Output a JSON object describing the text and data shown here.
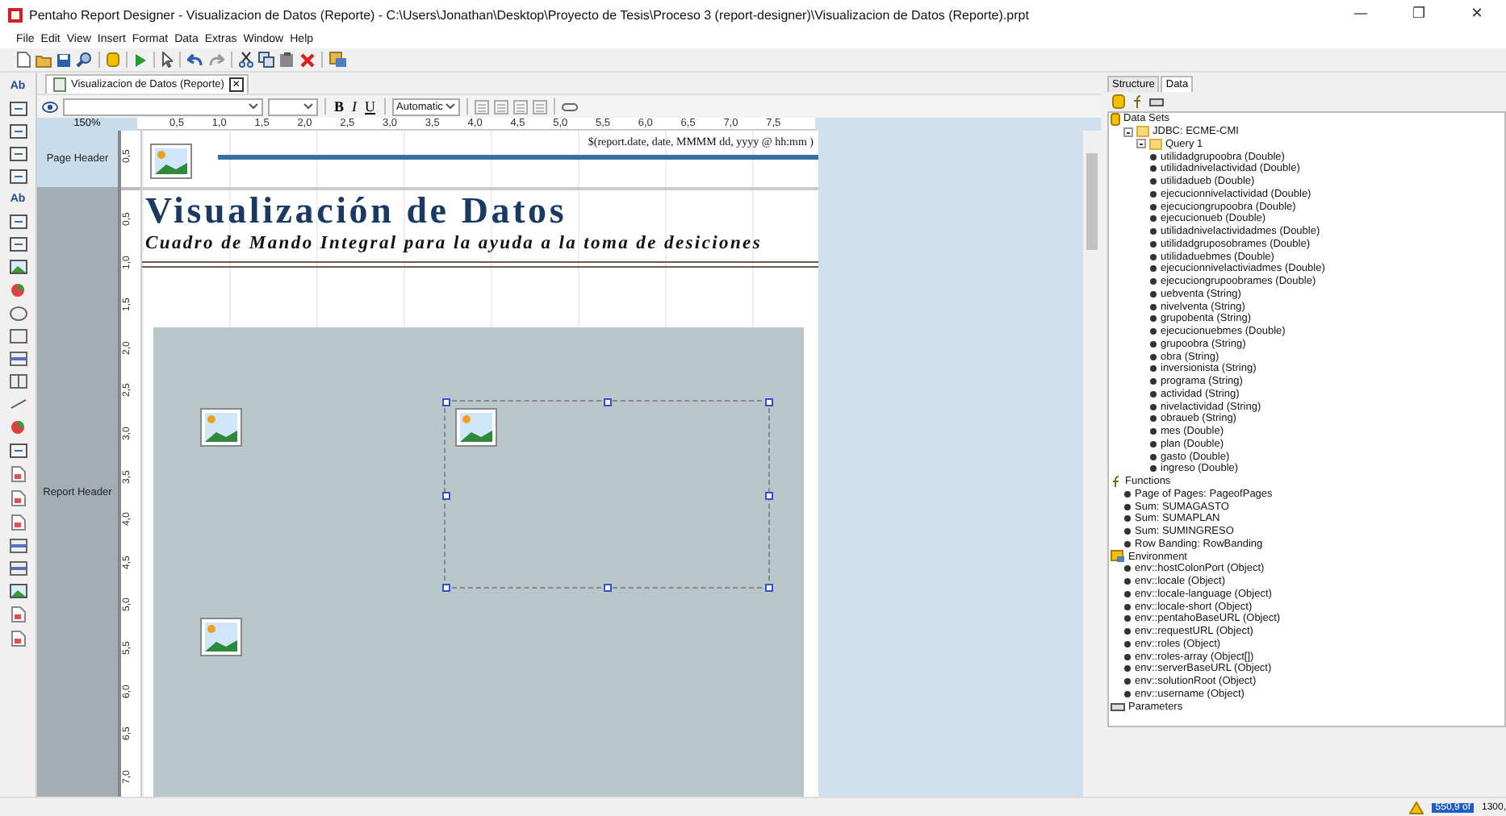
{
  "window": {
    "title": "Pentaho Report Designer - Visualizacion de Datos (Reporte) - C:\\Users\\Jonathan\\Desktop\\Proyecto de Tesis\\Proceso 3 (report-designer)\\Visualizacion de Datos (Reporte).prpt",
    "controls": [
      "—",
      "❐",
      "✕"
    ]
  },
  "menu": [
    "File",
    "Edit",
    "View",
    "Insert",
    "Format",
    "Data",
    "Extras",
    "Window",
    "Help"
  ],
  "toolbar": [
    {
      "kind": "new"
    },
    {
      "kind": "open"
    },
    {
      "kind": "save"
    },
    {
      "kind": "preview"
    },
    {
      "kind": "sep"
    },
    {
      "kind": "database"
    },
    {
      "kind": "sep"
    },
    {
      "kind": "run"
    },
    {
      "kind": "sep"
    },
    {
      "kind": "pointer"
    },
    {
      "kind": "sep"
    },
    {
      "kind": "undo"
    },
    {
      "kind": "redo"
    },
    {
      "kind": "sep"
    },
    {
      "kind": "cut"
    },
    {
      "kind": "copy"
    },
    {
      "kind": "paste"
    },
    {
      "kind": "delete"
    },
    {
      "kind": "sep"
    },
    {
      "kind": "publish"
    }
  ],
  "palette": [
    {
      "kind": "text",
      "label": "Ab"
    },
    {
      "kind": "box"
    },
    {
      "kind": "box"
    },
    {
      "kind": "box"
    },
    {
      "kind": "box"
    },
    {
      "kind": "text",
      "label": "Ab"
    },
    {
      "kind": "box"
    },
    {
      "kind": "box"
    },
    {
      "kind": "image"
    },
    {
      "kind": "chart"
    },
    {
      "kind": "ellipse"
    },
    {
      "kind": "rect"
    },
    {
      "kind": "band"
    },
    {
      "kind": "split"
    },
    {
      "kind": "line"
    },
    {
      "kind": "chart"
    },
    {
      "kind": "box"
    },
    {
      "kind": "doc"
    },
    {
      "kind": "doc"
    },
    {
      "kind": "doc"
    },
    {
      "kind": "band"
    },
    {
      "kind": "band"
    },
    {
      "kind": "image"
    },
    {
      "kind": "doc"
    },
    {
      "kind": "doc"
    }
  ],
  "document_tab": {
    "label": "Visualizacion de Datos (Reporte)",
    "close": "✕"
  },
  "format_toolbar": {
    "bold": "B",
    "italic": "I",
    "underline": "U",
    "color_choice": "Automatic"
  },
  "zoom": "150%",
  "ruler": [
    "0,5",
    "1,0",
    "1,5",
    "2,0",
    "2,5",
    "3,0",
    "3,5",
    "4,0",
    "4,5",
    "5,0",
    "5,5",
    "6,0",
    "6,5",
    "7,0",
    "7,5"
  ],
  "bands": [
    {
      "label": "Page Header",
      "selected": true,
      "ruler": [
        "0,5"
      ]
    },
    {
      "label": "Report Header",
      "selected": false,
      "ruler": [
        "0,5",
        "1,0",
        "1,5",
        "2,0",
        "2,5",
        "3,0",
        "3,5",
        "4,0",
        "4,5",
        "5,0",
        "5,5",
        "6,0",
        "6,5",
        "7,0"
      ]
    }
  ],
  "report": {
    "date_field": "$(report.date, date, MMMM dd, yyyy @ hh:mm )",
    "title": "Visualización de Datos",
    "subtitle": "Cuadro de Mando Integral para la ayuda a la toma de desiciones"
  },
  "side_tabs": [
    {
      "label": "Structure",
      "selected": false
    },
    {
      "label": "Data",
      "selected": true
    }
  ],
  "tree": [
    {
      "label": "Data Sets",
      "kind": "dataset",
      "children": [
        {
          "label": "JDBC: ECME-CMI",
          "kind": "folder",
          "expanded": true,
          "children": [
            {
              "label": "Query 1",
              "kind": "folder",
              "expanded": true,
              "children": [
                {
                  "label": "utilidadgrupoobra (Double)",
                  "kind": "field"
                },
                {
                  "label": "utilidadnivelactividad (Double)",
                  "kind": "field"
                },
                {
                  "label": "utilidadueb (Double)",
                  "kind": "field"
                },
                {
                  "label": "ejecucionnivelactividad (Double)",
                  "kind": "field"
                },
                {
                  "label": "ejecuciongrupoobra (Double)",
                  "kind": "field"
                },
                {
                  "label": "ejecucionueb (Double)",
                  "kind": "field"
                },
                {
                  "label": "utilidadnivelactividadmes (Double)",
                  "kind": "field"
                },
                {
                  "label": "utilidadgruposobrames (Double)",
                  "kind": "field"
                },
                {
                  "label": "utilidaduebmes (Double)",
                  "kind": "field"
                },
                {
                  "label": "ejecucionnivelactiviadmes (Double)",
                  "kind": "field"
                },
                {
                  "label": "ejecuciongrupoobrames (Double)",
                  "kind": "field"
                },
                {
                  "label": "uebventa (String)",
                  "kind": "field"
                },
                {
                  "label": "nivelventa (String)",
                  "kind": "field"
                },
                {
                  "label": "grupobenta (String)",
                  "kind": "field"
                },
                {
                  "label": "ejecucionuebmes (Double)",
                  "kind": "field"
                },
                {
                  "label": "grupoobra (String)",
                  "kind": "field"
                },
                {
                  "label": "obra (String)",
                  "kind": "field"
                },
                {
                  "label": "inversionista (String)",
                  "kind": "field"
                },
                {
                  "label": "programa (String)",
                  "kind": "field"
                },
                {
                  "label": "actividad (String)",
                  "kind": "field"
                },
                {
                  "label": "nivelactividad (String)",
                  "kind": "field"
                },
                {
                  "label": "obraueb (String)",
                  "kind": "field"
                },
                {
                  "label": "mes (Double)",
                  "kind": "field"
                },
                {
                  "label": "plan (Double)",
                  "kind": "field"
                },
                {
                  "label": "gasto (Double)",
                  "kind": "field"
                },
                {
                  "label": "ingreso (Double)",
                  "kind": "field"
                }
              ]
            }
          ]
        }
      ]
    },
    {
      "label": "Functions",
      "kind": "functions",
      "children": [
        {
          "label": "Page of Pages: PageofPages",
          "kind": "field"
        },
        {
          "label": "Sum: SUMAGASTO",
          "kind": "field"
        },
        {
          "label": "Sum: SUMAPLAN",
          "kind": "field"
        },
        {
          "label": "Sum: SUMINGRESO",
          "kind": "field"
        },
        {
          "label": "Row Banding: RowBanding",
          "kind": "field"
        }
      ]
    },
    {
      "label": "Environment",
      "kind": "environment",
      "children": [
        {
          "label": "env::hostColonPort (Object)",
          "kind": "field"
        },
        {
          "label": "env::locale (Object)",
          "kind": "field"
        },
        {
          "label": "env::locale-language (Object)",
          "kind": "field"
        },
        {
          "label": "env::locale-short (Object)",
          "kind": "field"
        },
        {
          "label": "env::pentahoBaseURL (Object)",
          "kind": "field"
        },
        {
          "label": "env::requestURL (Object)",
          "kind": "field"
        },
        {
          "label": "env::roles (Object)",
          "kind": "field"
        },
        {
          "label": "env::roles-array (Object[])",
          "kind": "field"
        },
        {
          "label": "env::serverBaseURL (Object)",
          "kind": "field"
        },
        {
          "label": "env::solutionRoot (Object)",
          "kind": "field"
        },
        {
          "label": "env::username (Object)",
          "kind": "field"
        }
      ]
    },
    {
      "label": "Parameters",
      "kind": "parameters"
    }
  ],
  "status_bar": {
    "memory": "550,9 of",
    "total": "1300,"
  }
}
